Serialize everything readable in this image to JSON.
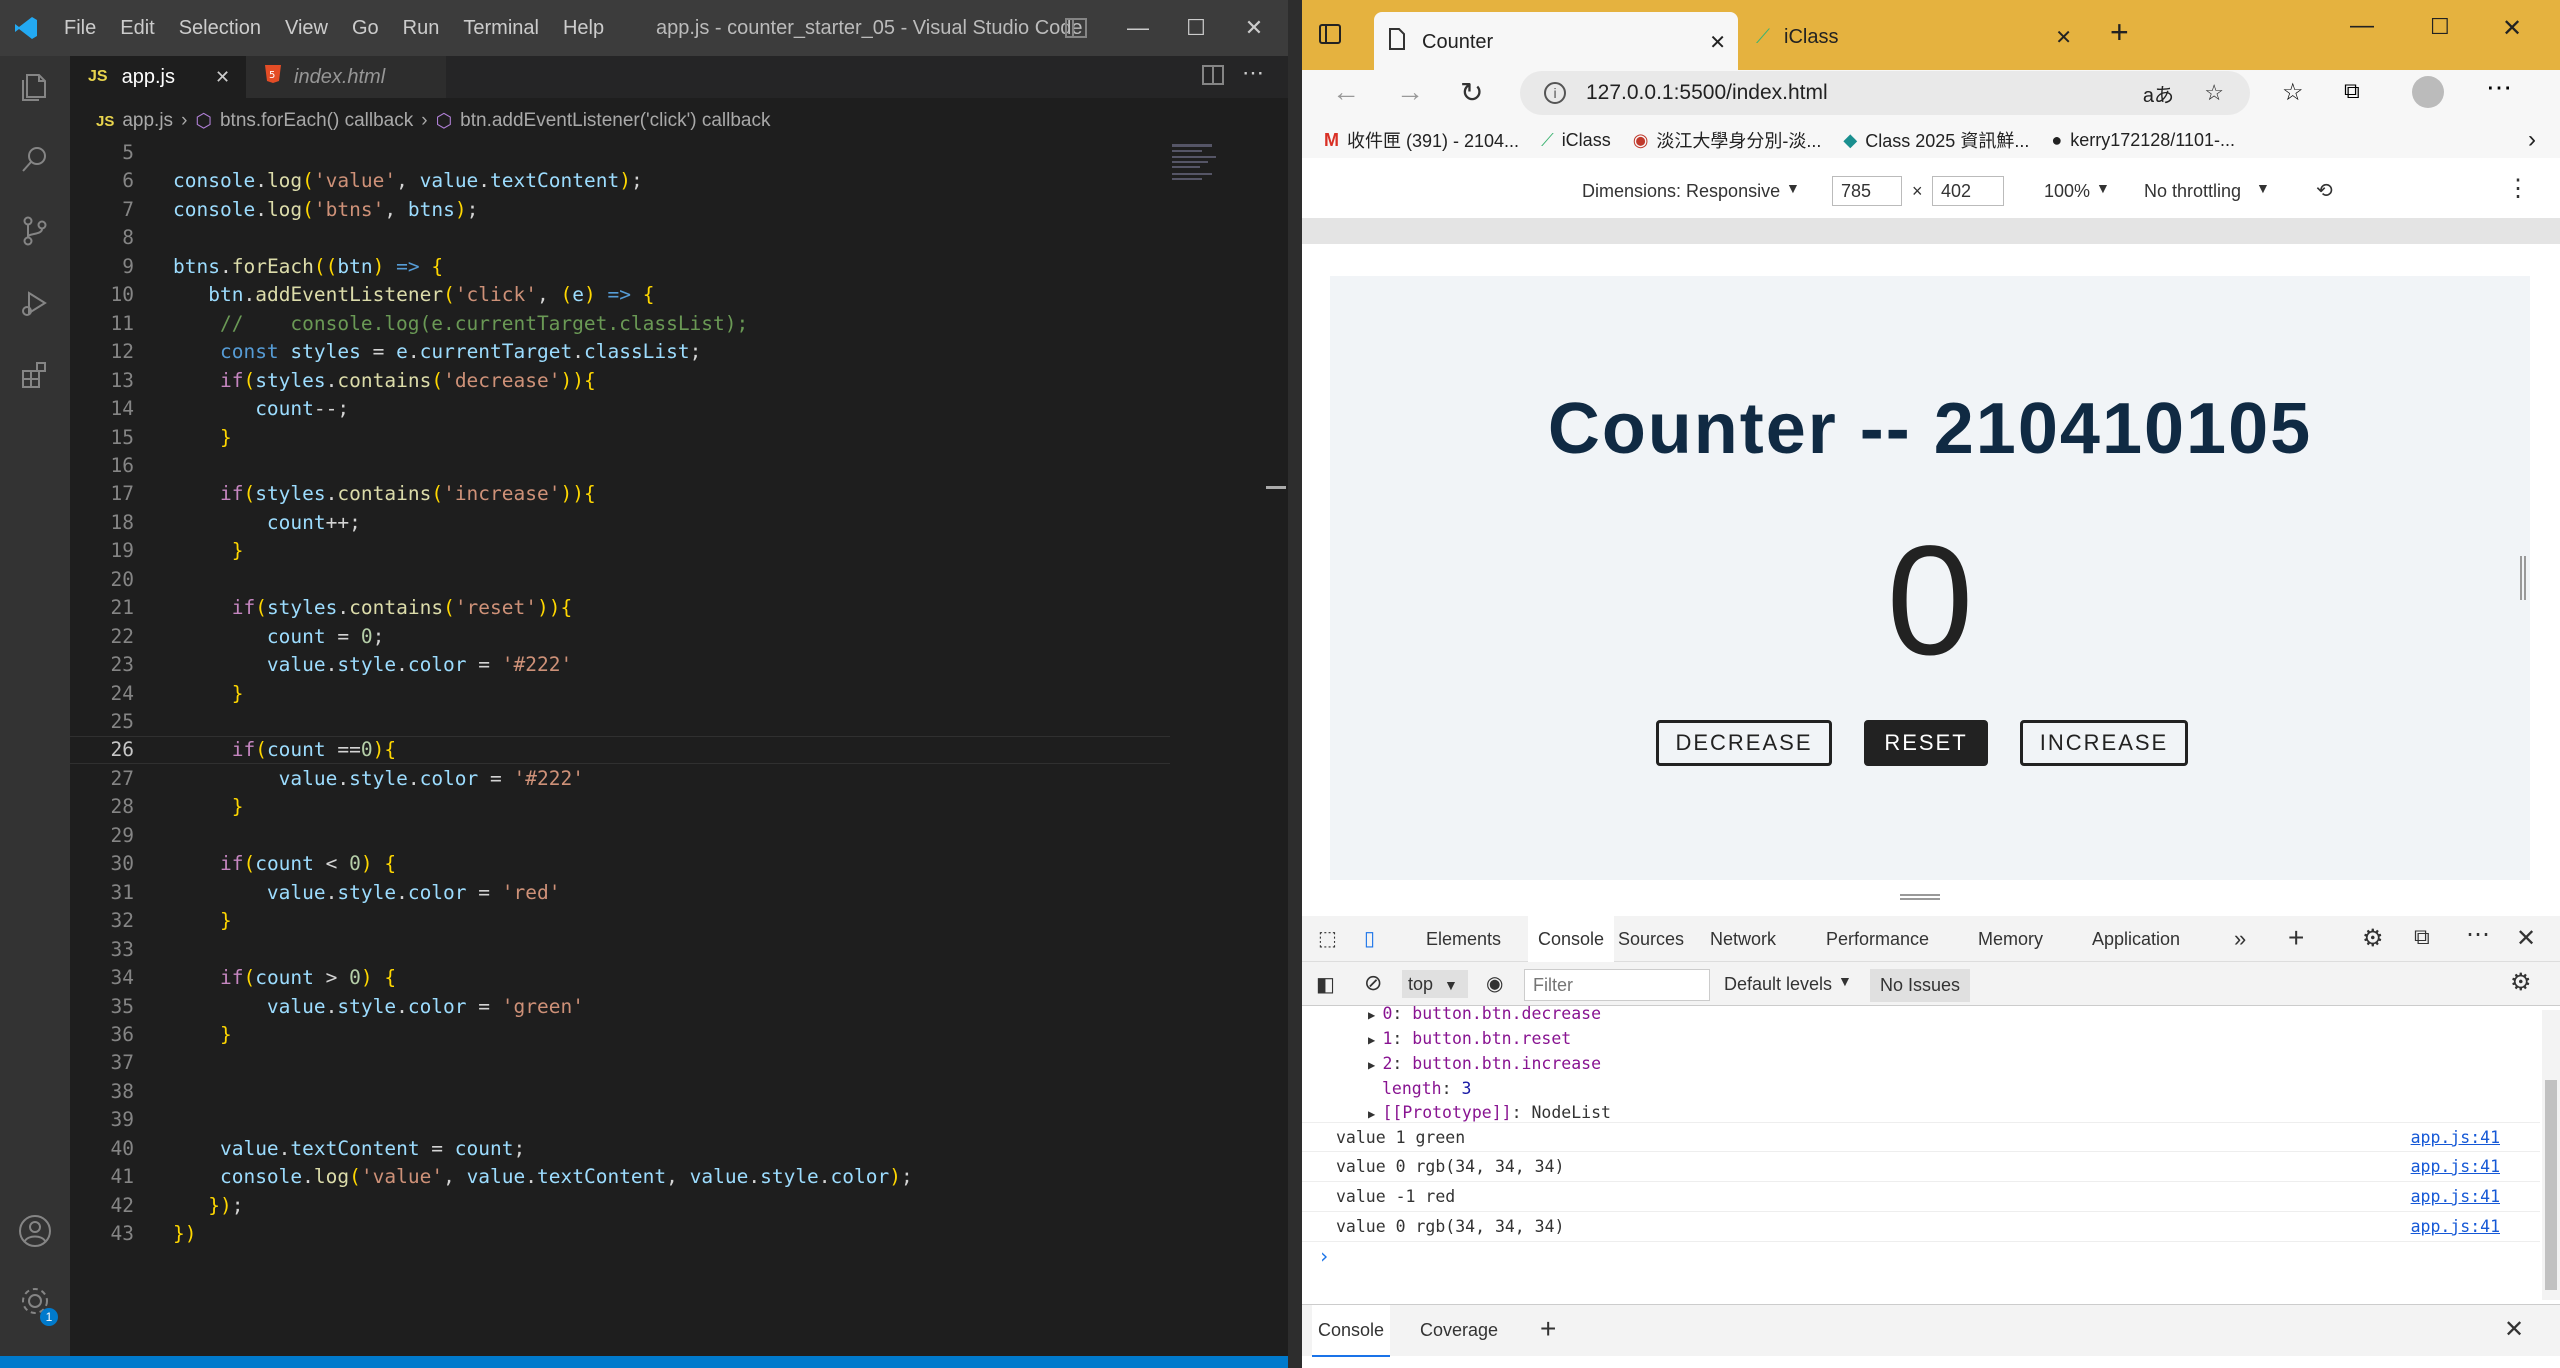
{
  "vscode": {
    "menu": [
      "File",
      "Edit",
      "Selection",
      "View",
      "Go",
      "Run",
      "Terminal",
      "Help"
    ],
    "window_title": "app.js - counter_starter_05 - Visual Studio Code",
    "tabs": [
      {
        "label": "app.js",
        "badge": "JS"
      },
      {
        "label": "index.html"
      }
    ],
    "breadcrumb": [
      "app.js",
      "btns.forEach() callback",
      "btn.addEventListener('click') callback"
    ],
    "breadcrumb_file_badge": "JS",
    "account_badge": "1",
    "lines": [
      {
        "n": "5",
        "t": ""
      },
      {
        "n": "6",
        "t": "console.log('value', value.textContent);"
      },
      {
        "n": "7",
        "t": "console.log('btns', btns);"
      },
      {
        "n": "8",
        "t": ""
      },
      {
        "n": "9",
        "t": "btns.forEach((btn) => {"
      },
      {
        "n": "10",
        "t": "   btn.addEventListener('click', (e) => {"
      },
      {
        "n": "11",
        "t": "    //    console.log(e.currentTarget.classList);"
      },
      {
        "n": "12",
        "t": "    const styles = e.currentTarget.classList;"
      },
      {
        "n": "13",
        "t": "    if(styles.contains('decrease')){"
      },
      {
        "n": "14",
        "t": "       count--;"
      },
      {
        "n": "15",
        "t": "    }"
      },
      {
        "n": "16",
        "t": ""
      },
      {
        "n": "17",
        "t": "    if(styles.contains('increase')){"
      },
      {
        "n": "18",
        "t": "        count++;"
      },
      {
        "n": "19",
        "t": "     }"
      },
      {
        "n": "20",
        "t": ""
      },
      {
        "n": "21",
        "t": "     if(styles.contains('reset')){"
      },
      {
        "n": "22",
        "t": "        count = 0;"
      },
      {
        "n": "23",
        "t": "        value.style.color = '#222'"
      },
      {
        "n": "24",
        "t": "     }"
      },
      {
        "n": "25",
        "t": ""
      },
      {
        "n": "26",
        "t": "     if(count ==0){"
      },
      {
        "n": "27",
        "t": "         value.style.color = '#222'"
      },
      {
        "n": "28",
        "t": "     }"
      },
      {
        "n": "29",
        "t": ""
      },
      {
        "n": "30",
        "t": "    if(count < 0) {"
      },
      {
        "n": "31",
        "t": "        value.style.color = 'red'"
      },
      {
        "n": "32",
        "t": "    }"
      },
      {
        "n": "33",
        "t": ""
      },
      {
        "n": "34",
        "t": "    if(count > 0) {"
      },
      {
        "n": "35",
        "t": "        value.style.color = 'green'"
      },
      {
        "n": "36",
        "t": "    }"
      },
      {
        "n": "37",
        "t": ""
      },
      {
        "n": "38",
        "t": ""
      },
      {
        "n": "39",
        "t": ""
      },
      {
        "n": "40",
        "t": "    value.textContent = count;"
      },
      {
        "n": "41",
        "t": "    console.log('value', value.textContent, value.style.color);"
      },
      {
        "n": "42",
        "t": "   });"
      },
      {
        "n": "43",
        "t": "})"
      }
    ],
    "active_line": "26"
  },
  "browser": {
    "tabs": [
      {
        "label": "Counter"
      },
      {
        "label": "iClass"
      }
    ],
    "url": "127.0.0.1:5500/index.html",
    "read_aloud": "aあ",
    "bookmarks": [
      "收件匣 (391) - 2104...",
      "iClass",
      "淡江大學身分別-淡...",
      "Class 2025 資訊鮮...",
      "kerry172128/1101-..."
    ],
    "device_toolbar": {
      "dimensions": "Dimensions: Responsive",
      "width": "785",
      "x": "×",
      "height": "402",
      "zoom": "100%",
      "throttling": "No throttling"
    },
    "page": {
      "title": "Counter -- 210410105",
      "value": "0",
      "buttons": [
        "DECREASE",
        "RESET",
        "INCREASE"
      ]
    },
    "devtools": {
      "tabs": [
        "Elements",
        "Console",
        "Sources",
        "Network",
        "Performance",
        "Memory",
        "Application"
      ],
      "active_tab": "Console",
      "context": "top",
      "filter_placeholder": "Filter",
      "levels": "Default levels",
      "issues": "No Issues",
      "tree": [
        {
          "k": "0",
          "v": "button.btn.decrease"
        },
        {
          "k": "1",
          "v": "button.btn.reset"
        },
        {
          "k": "2",
          "v": "button.btn.increase"
        }
      ],
      "length_label": "length",
      "length_value": "3",
      "prototype": "[[Prototype]]",
      "prototype_value": "NodeList",
      "logs": [
        {
          "text": "value 1 green",
          "src": "app.js:41"
        },
        {
          "text": "value 0 rgb(34, 34, 34)",
          "src": "app.js:41"
        },
        {
          "text": "value -1 red",
          "src": "app.js:41"
        },
        {
          "text": "value 0 rgb(34, 34, 34)",
          "src": "app.js:41"
        }
      ],
      "prompt": "›",
      "drawer_tabs": [
        "Console",
        "Coverage"
      ]
    }
  }
}
